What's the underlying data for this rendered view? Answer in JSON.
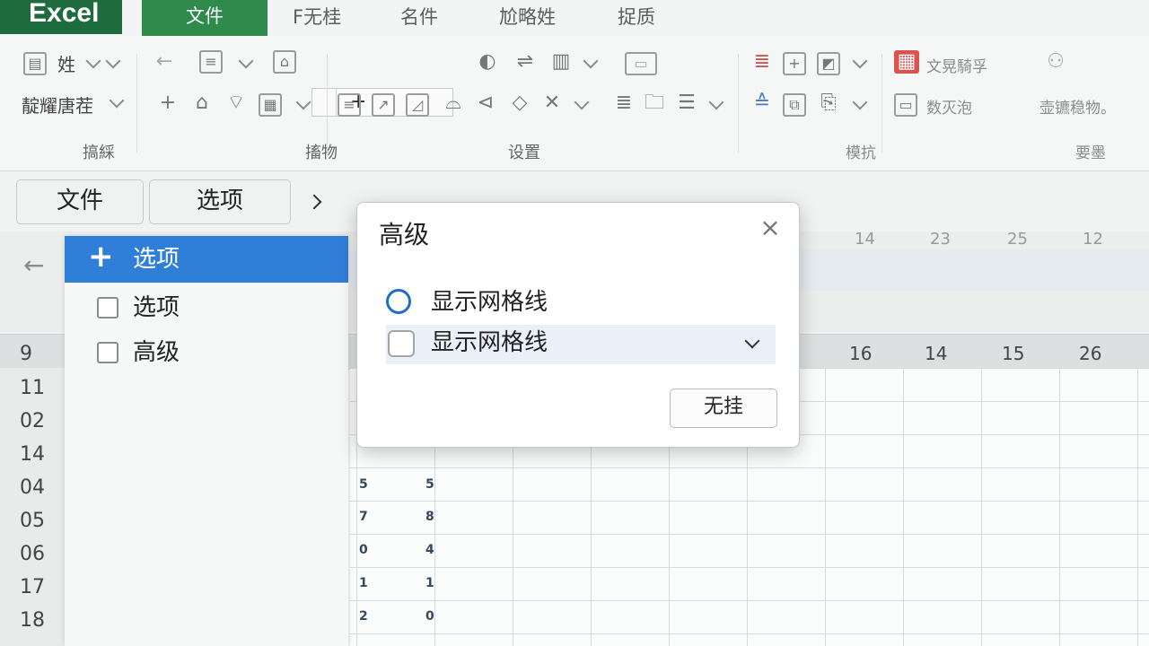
{
  "app": {
    "name": "Excel"
  },
  "tabs": [
    {
      "label": "文件",
      "active": true
    },
    {
      "label": "F无桂"
    },
    {
      "label": "名件"
    },
    {
      "label": "尬略姓"
    },
    {
      "label": "捉质"
    }
  ],
  "ribbon": {
    "row1_left": "姓",
    "row2_left": "靛耀唐茬",
    "combo_value": "+",
    "text_a": "文晃騎孚",
    "text_b": "数灭泡",
    "text_c": "壶镳稳物。",
    "groups": [
      "搞綵",
      "搐物",
      "设置",
      "模抗",
      "要墨"
    ]
  },
  "toolbar": {
    "file_label": "文件",
    "options_label": "选项"
  },
  "menu": {
    "items": [
      {
        "label": "选项",
        "selected": true
      },
      {
        "label": "选项"
      },
      {
        "label": "高级"
      }
    ]
  },
  "dialog": {
    "title": "高级",
    "option1": "显示网格线",
    "option2": "显示网格线",
    "button": "无挂"
  },
  "sheet": {
    "top_headers": [
      "14",
      "23",
      "25",
      "12"
    ],
    "col_headers": [
      "16",
      "14",
      "15",
      "26"
    ],
    "row_numbers": [
      "9",
      "11",
      "02",
      "14",
      "04",
      "05",
      "06",
      "17",
      "18"
    ],
    "cells_col_a": [
      "5",
      "7",
      "0",
      "1",
      "2"
    ],
    "cells_col_b": [
      "5",
      "8",
      "4",
      "1",
      "0"
    ]
  },
  "colors": {
    "brand": "#1e6b3e",
    "tab_active": "#2f8b4c",
    "selection": "#2f7ed8",
    "radio": "#1f6fc4"
  },
  "icons": [
    "sheet-icon",
    "undo-icon",
    "format-icon",
    "paint-icon",
    "add-icon",
    "home-icon",
    "layers-icon",
    "grid-icon",
    "close-icon",
    "chevron-down-icon",
    "chevron-right-icon",
    "back-arrow-icon",
    "plus-icon"
  ]
}
